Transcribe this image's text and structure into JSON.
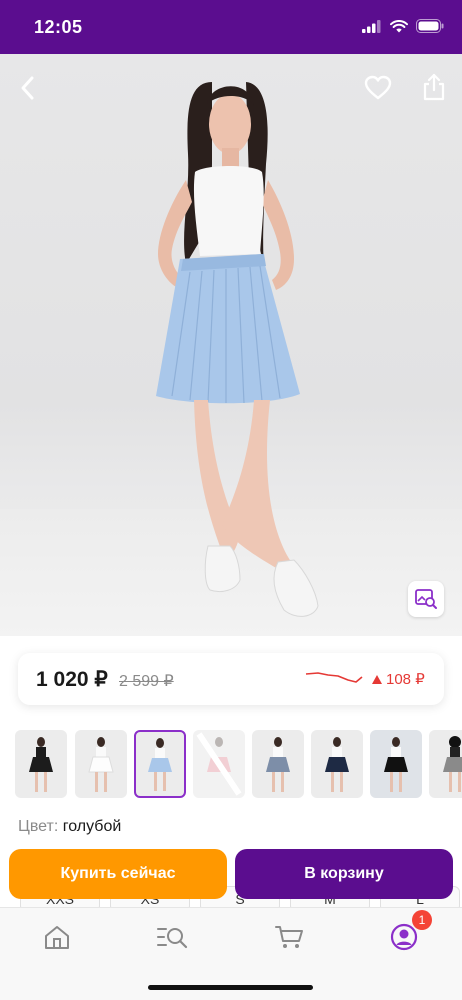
{
  "status_bar": {
    "time": "12:05"
  },
  "hero": {
    "back_icon": "chevron-left-icon",
    "favorite_icon": "heart-icon",
    "share_icon": "share-icon",
    "visual_search_icon": "image-search-icon"
  },
  "price": {
    "current": "1 020 ₽",
    "old": "2 599 ₽",
    "change": "108 ₽"
  },
  "thumbnails": {
    "count": 8,
    "selected_index": 2
  },
  "color": {
    "label": "Цвет:",
    "value": "голубой"
  },
  "sizes": [
    "XXS",
    "XS",
    "S",
    "M",
    "L"
  ],
  "actions": {
    "buy_now": "Купить сейчас",
    "add_to_cart": "В корзину"
  },
  "bottom_nav": {
    "items": [
      "home-icon",
      "catalog-search-icon",
      "cart-icon",
      "profile-icon"
    ],
    "profile_badge": "1"
  },
  "colors": {
    "brand": "#5b0d8f",
    "buy": "#ff9800",
    "price_up": "#e53935",
    "skirt": "#a9c7ea"
  }
}
